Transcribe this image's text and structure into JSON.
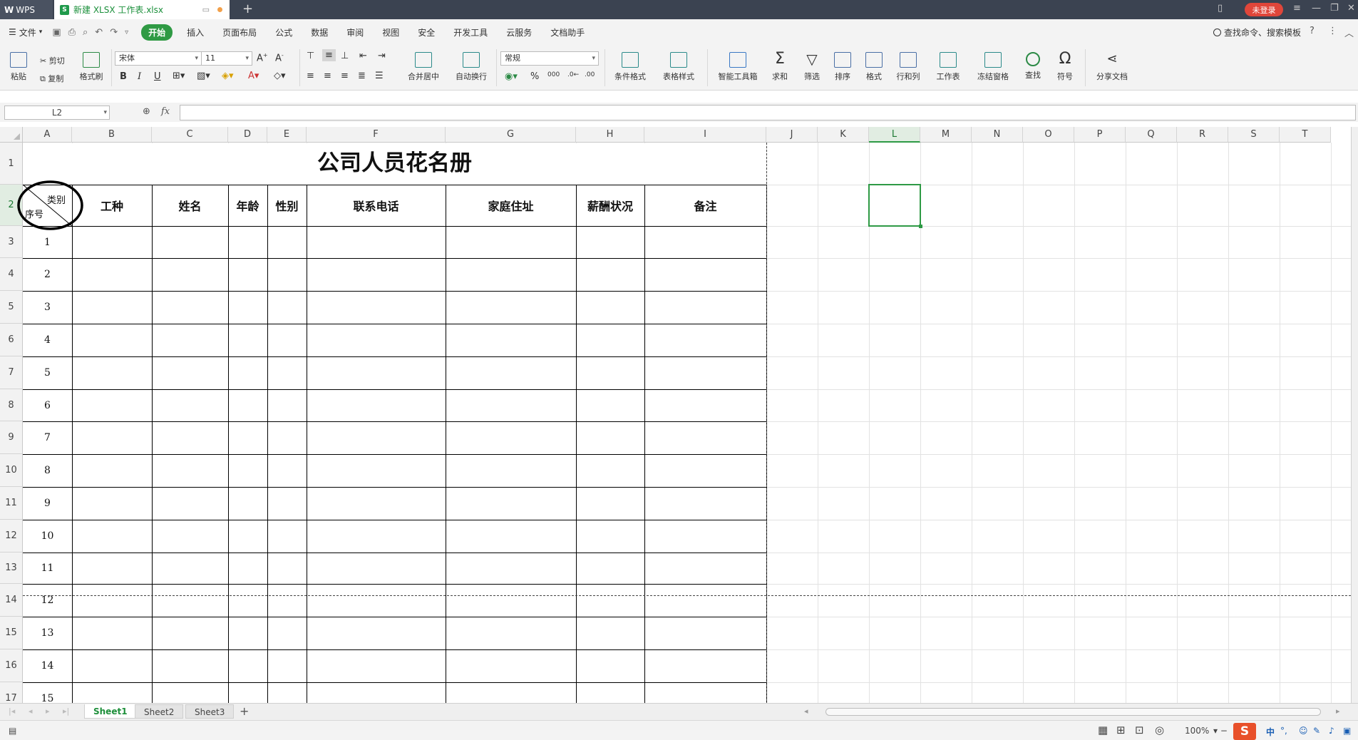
{
  "titlebar": {
    "app_tab": "WPS",
    "doc_tab": "新建 XLSX 工作表.xlsx",
    "new_tab": "+",
    "login": "未登录"
  },
  "menu": {
    "file": "文件",
    "items": [
      "开始",
      "插入",
      "页面布局",
      "公式",
      "数据",
      "审阅",
      "视图",
      "安全",
      "开发工具",
      "云服务",
      "文档助手"
    ],
    "search": "查找命令、搜索模板",
    "help": "?"
  },
  "ribbon": {
    "paste": "粘贴",
    "cut": "剪切",
    "copy": "复制",
    "format_painter": "格式刷",
    "font_name": "宋体",
    "font_size": "11",
    "merge_center": "合并居中",
    "wrap": "自动换行",
    "number_format": "常规",
    "cond_format": "条件格式",
    "table_style": "表格样式",
    "smart_toolbox": "智能工具箱",
    "sum": "求和",
    "filter": "筛选",
    "sort": "排序",
    "format": "格式",
    "rows_cols": "行和列",
    "worksheet": "工作表",
    "freeze": "冻结窗格",
    "find": "查找",
    "symbol": "符号",
    "share": "分享文档"
  },
  "formula": {
    "name_box": "L2",
    "fx": "fx",
    "content": ""
  },
  "grid": {
    "columns": [
      "A",
      "B",
      "C",
      "D",
      "E",
      "F",
      "G",
      "H",
      "I",
      "J",
      "K",
      "L",
      "M",
      "N",
      "O",
      "P",
      "Q",
      "R",
      "S",
      "T"
    ],
    "rows": [
      "1",
      "2",
      "3",
      "4",
      "5",
      "6",
      "7",
      "8",
      "9",
      "10",
      "11",
      "12",
      "13",
      "14",
      "15",
      "16",
      "17"
    ],
    "title": "公司人员花名册",
    "diag_top": "类别",
    "diag_bottom": "序号",
    "headers": [
      "工种",
      "姓名",
      "年龄",
      "性别",
      "联系电话",
      "家庭住址",
      "薪酬状况",
      "备注"
    ],
    "serials": [
      "1",
      "2",
      "3",
      "4",
      "5",
      "6",
      "7",
      "8",
      "9",
      "10",
      "11",
      "12",
      "13",
      "14",
      "15"
    ]
  },
  "sheets": {
    "tabs": [
      "Sheet1",
      "Sheet2",
      "Sheet3"
    ],
    "add": "+"
  },
  "status": {
    "zoom": "100%",
    "ime": "S",
    "ime_lang": "中"
  }
}
